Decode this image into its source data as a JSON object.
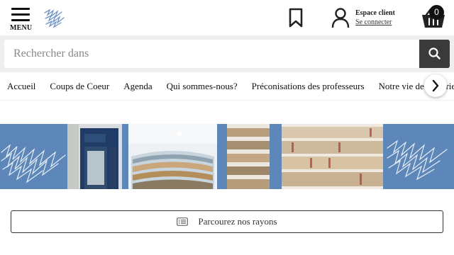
{
  "header": {
    "menu_label": "MENU",
    "account_title": "Espace client",
    "account_link": "Se connecter",
    "cart_count": "0",
    "icons": [
      "menu-icon",
      "logo-icon",
      "bookmark-icon",
      "user-icon",
      "basket-icon"
    ]
  },
  "search": {
    "placeholder": "Rechercher dans",
    "button_icon": "search-icon"
  },
  "nav": {
    "items": [
      {
        "label": "Accueil"
      },
      {
        "label": "Coups de Coeur"
      },
      {
        "label": "Agenda"
      },
      {
        "label": "Qui sommes-nous?"
      },
      {
        "label": "Préconisations des professeurs"
      },
      {
        "label": "Notre vie de librairie"
      }
    ],
    "next_icon": "chevron-right-icon"
  },
  "browse": {
    "label": "Parcourez nos rayons",
    "icon": "list-icon"
  },
  "colors": {
    "banner": "#5d87b8",
    "search_button": "#3a3a3a",
    "badge": "#111111"
  }
}
